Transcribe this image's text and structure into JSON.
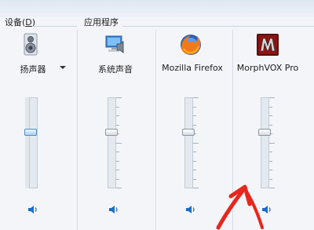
{
  "devices": {
    "label": "设备",
    "shortcut": "D"
  },
  "applications": {
    "label": "应用程序"
  },
  "channels": [
    {
      "id": "speaker",
      "label": "扬声器",
      "icon": "speaker-device-icon",
      "volume_fraction": 0.62,
      "has_dropdown": true,
      "active": true
    },
    {
      "id": "system-sounds",
      "label": "系统声音",
      "icon": "system-sounds-icon",
      "volume_fraction": 0.62,
      "has_dropdown": false,
      "active": false
    },
    {
      "id": "firefox",
      "label": "Mozilla Firefox",
      "icon": "firefox-icon",
      "volume_fraction": 0.62,
      "has_dropdown": false,
      "active": false
    },
    {
      "id": "morphvox",
      "label": "MorphVOX Pro",
      "icon": "morphvox-icon",
      "volume_fraction": 0.62,
      "has_dropdown": false,
      "active": false
    }
  ],
  "colors": {
    "annotation_arrow": "#e8261c",
    "active_thumb": "#4f8fc6",
    "speaker_blue": "#1b6cc9"
  }
}
